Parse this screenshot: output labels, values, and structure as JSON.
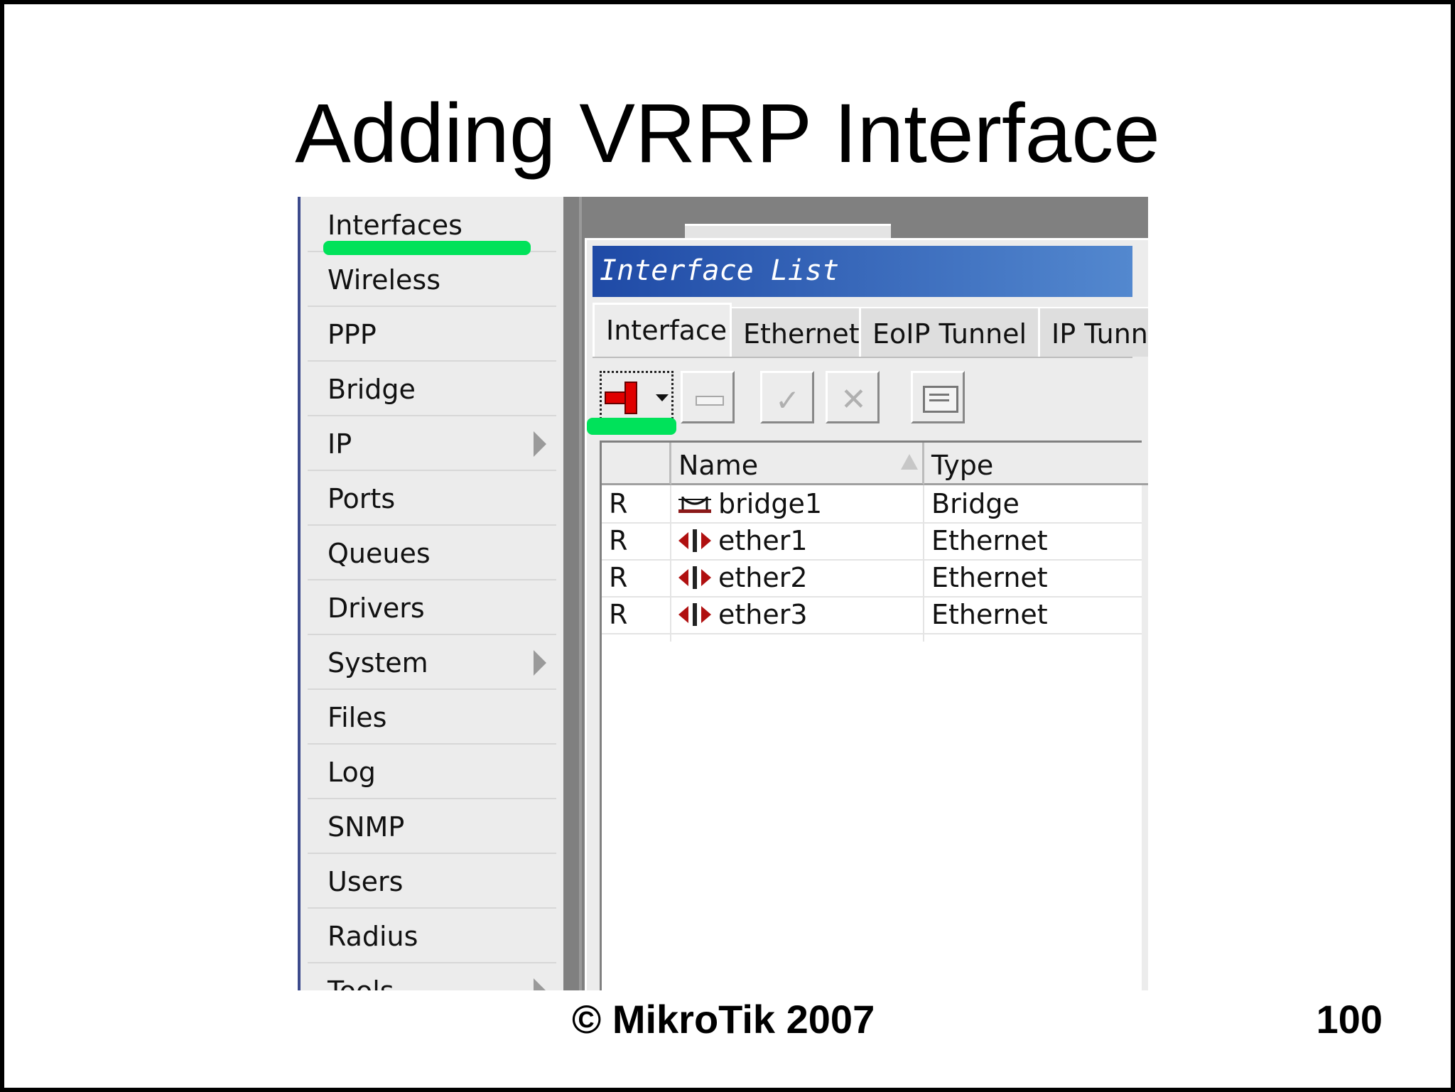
{
  "slide": {
    "title": "Adding VRRP Interface",
    "footer_copyright": "© MikroTik 2007",
    "page_number": "100"
  },
  "menu": {
    "items": [
      {
        "label": "Interfaces",
        "has_submenu": false
      },
      {
        "label": "Wireless",
        "has_submenu": false
      },
      {
        "label": "PPP",
        "has_submenu": false
      },
      {
        "label": "Bridge",
        "has_submenu": false
      },
      {
        "label": "IP",
        "has_submenu": true
      },
      {
        "label": "Ports",
        "has_submenu": false
      },
      {
        "label": "Queues",
        "has_submenu": false
      },
      {
        "label": "Drivers",
        "has_submenu": false
      },
      {
        "label": "System",
        "has_submenu": true
      },
      {
        "label": "Files",
        "has_submenu": false
      },
      {
        "label": "Log",
        "has_submenu": false
      },
      {
        "label": "SNMP",
        "has_submenu": false
      },
      {
        "label": "Users",
        "has_submenu": false
      },
      {
        "label": "Radius",
        "has_submenu": false
      },
      {
        "label": "Tools",
        "has_submenu": true
      }
    ]
  },
  "window": {
    "title": "Interface List",
    "tabs": [
      {
        "label": "Interface",
        "active": true
      },
      {
        "label": "Ethernet",
        "active": false
      },
      {
        "label": "EoIP Tunnel",
        "active": false
      },
      {
        "label": "IP Tunnel",
        "active": false
      }
    ],
    "toolbar": {
      "buttons": [
        "add-icon",
        "remove-icon",
        "enable-icon",
        "disable-icon",
        "comment-icon"
      ]
    },
    "table": {
      "columns": [
        "",
        "Name",
        "Type"
      ],
      "rows": [
        {
          "flag": "R",
          "icon": "bridge-icon",
          "name": "bridge1",
          "type": "Bridge"
        },
        {
          "flag": "R",
          "icon": "ethernet-icon",
          "name": "ether1",
          "type": "Ethernet"
        },
        {
          "flag": "R",
          "icon": "ethernet-icon",
          "name": "ether2",
          "type": "Ethernet"
        },
        {
          "flag": "R",
          "icon": "ethernet-icon",
          "name": "ether3",
          "type": "Ethernet"
        }
      ]
    }
  },
  "colors": {
    "highlight_green": "#00e25a",
    "titlebar_start": "#1f4aa6",
    "titlebar_end": "#5388cf",
    "add_icon_red": "#e00000"
  }
}
